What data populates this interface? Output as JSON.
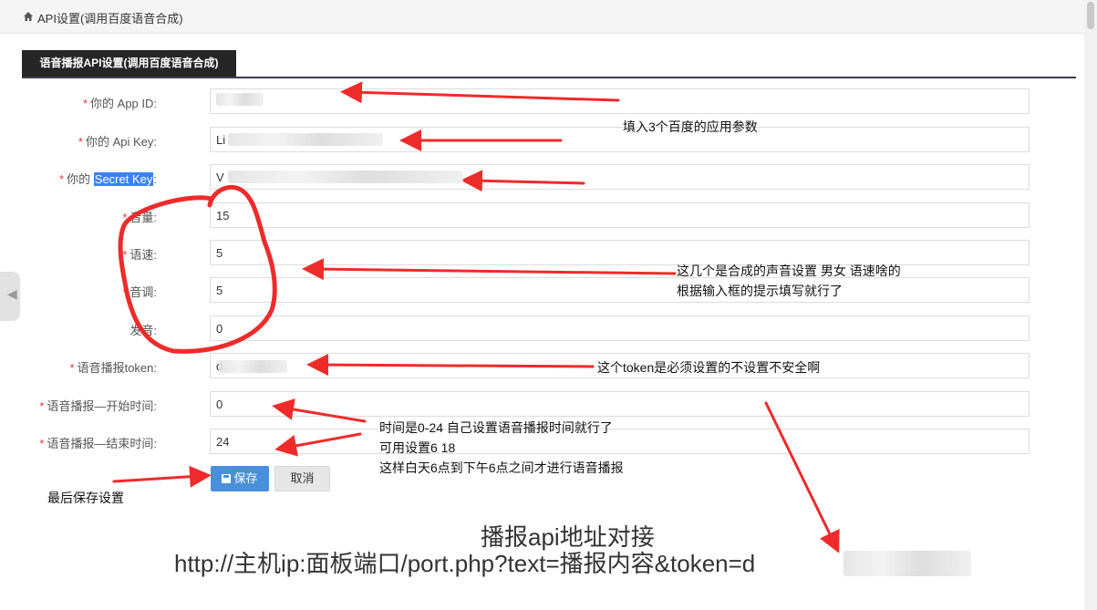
{
  "breadcrumb": {
    "title": "API设置(调用百度语音合成)"
  },
  "tab": {
    "label": "语音播报API设置(调用百度语音合成)"
  },
  "form": {
    "rows": [
      {
        "label_prefix": "你的 App ID:",
        "value": ""
      },
      {
        "label_prefix": "你的 Api Key:",
        "value": "Li"
      },
      {
        "label_prefix": "你的 ",
        "label_highlight": "Secret Key",
        "label_suffix": ":",
        "value": "V"
      },
      {
        "label_prefix": "音量:",
        "value": "15"
      },
      {
        "label_prefix": "语速:",
        "value": "5"
      },
      {
        "label_prefix": "音调:",
        "value": "5"
      },
      {
        "label_prefix": "发音:",
        "value": "0"
      },
      {
        "label_prefix": "语音播报token:",
        "value": "d"
      },
      {
        "label_prefix": "语音播报—开始时间:",
        "value": "0"
      },
      {
        "label_prefix": "语音播报—结束时间:",
        "value": "24"
      }
    ],
    "required_mark": "*",
    "save_label": "保存",
    "cancel_label": "取消"
  },
  "annotations": {
    "fill_params": "填入3个百度的应用参数",
    "voice_line1": "这几个是合成的声音设置 男女 语速啥的",
    "voice_line2": "根据输入框的提示填写就行了",
    "token_note": "这个token是必须设置的不设置不安全啊",
    "time_line1": "时间是0-24 自己设置语音播报时间就行了",
    "time_line2": "可用设置6 18",
    "time_line3": "这样白天6点到下午6点之间才进行语音播报",
    "save_note": "最后保存设置",
    "api_title": "播报api地址对接",
    "api_url": "http://主机ip:面板端口/port.php?text=播报内容&token=d"
  },
  "colors": {
    "accent": "#4a8fdc",
    "tab_bg": "#262626",
    "required": "#e4393c",
    "annotation_red": "#ee2b2b"
  }
}
